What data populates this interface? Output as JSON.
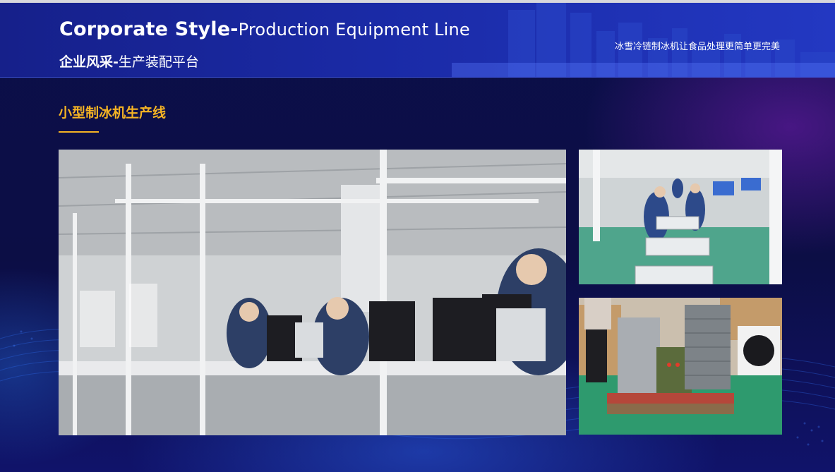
{
  "header": {
    "title_en_bold": "Corporate Style-",
    "title_en_light": "Production Equipment Line",
    "title_cn_bold": "企业风采-",
    "title_cn_light": "生产装配平台",
    "slogan": "冰雪冷链制冰机让食品处理更简单更完美"
  },
  "section": {
    "title": "小型制冰机生产线"
  },
  "colors": {
    "accent": "#f5b324",
    "header_blue": "#1a2aa6",
    "background": "#0b0f4a"
  }
}
